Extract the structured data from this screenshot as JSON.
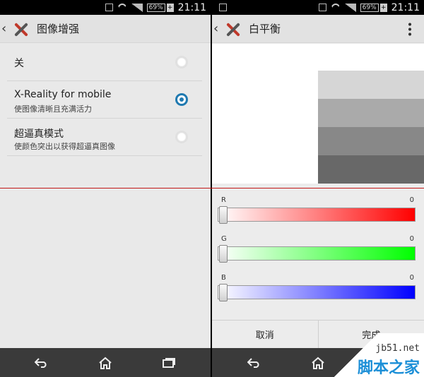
{
  "left": {
    "status": {
      "battery": "69%",
      "time": "21:11"
    },
    "title": "图像增强",
    "items": [
      {
        "label": "关",
        "sub": "",
        "selected": false
      },
      {
        "label": "X-Reality for mobile",
        "sub": "使图像清晰且充满活力",
        "selected": true
      },
      {
        "label": "超逼真模式",
        "sub": "使颜色突出以获得超逼真图像",
        "selected": false
      }
    ]
  },
  "right": {
    "status": {
      "battery": "69%",
      "time": "21:11"
    },
    "title": "白平衡",
    "preview_bars": [
      "#d6d6d6",
      "#aaaaaa",
      "#888888",
      "#686868"
    ],
    "sliders": [
      {
        "label": "R",
        "value": "0",
        "color": "#ff0000"
      },
      {
        "label": "G",
        "value": "0",
        "color": "#00ff00"
      },
      {
        "label": "B",
        "value": "0",
        "color": "#0000ff"
      }
    ],
    "cancel_label": "取消",
    "done_label": "完成"
  },
  "watermark": {
    "site": "jb51.net",
    "brand": "脚本之家"
  },
  "colors": {
    "accent": "#1f79b0",
    "divider_red": "#c21818"
  }
}
